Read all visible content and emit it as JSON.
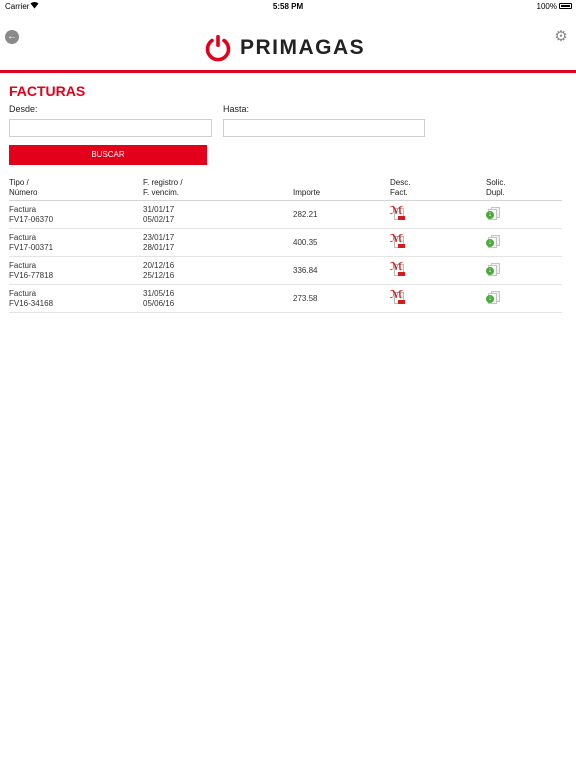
{
  "status_bar": {
    "carrier": "Carrier",
    "time": "5:58 PM",
    "battery": "100%"
  },
  "header": {
    "logo_text": "PRIMAGAS",
    "brand_color": "#e3001b",
    "back_icon": "back-arrow-icon",
    "settings_icon": "gear-icon"
  },
  "page": {
    "title": "FACTURAS"
  },
  "filters": {
    "desde_label": "Desde:",
    "desde_value": "",
    "hasta_label": "Hasta:",
    "hasta_value": "",
    "search_label": "BUSCAR"
  },
  "table": {
    "headers": {
      "tipo": [
        "Tipo /",
        "Número"
      ],
      "fecha": [
        "F. registro /",
        "F. vencim."
      ],
      "importe": "Importe",
      "desc": [
        "Desc.",
        "Fact."
      ],
      "solic": [
        "Solic.",
        "Dupl."
      ]
    },
    "rows": [
      {
        "tipo": "Factura",
        "numero": "FV17-06370",
        "registro": "31/01/17",
        "vencim": "05/02/17",
        "importe": "282.21",
        "desc_icon": "pdf-icon",
        "solic_icon": "duplicate-request-icon"
      },
      {
        "tipo": "Factura",
        "numero": "FV17-00371",
        "registro": "23/01/17",
        "vencim": "28/01/17",
        "importe": "400.35",
        "desc_icon": "pdf-icon",
        "solic_icon": "duplicate-request-icon"
      },
      {
        "tipo": "Factura",
        "numero": "FV16-77818",
        "registro": "20/12/16",
        "vencim": "25/12/16",
        "importe": "336.84",
        "desc_icon": "pdf-icon",
        "solic_icon": "duplicate-request-icon"
      },
      {
        "tipo": "Factura",
        "numero": "FV16-34168",
        "registro": "31/05/16",
        "vencim": "05/06/16",
        "importe": "273.58",
        "desc_icon": "pdf-icon",
        "solic_icon": "duplicate-request-icon"
      }
    ]
  }
}
